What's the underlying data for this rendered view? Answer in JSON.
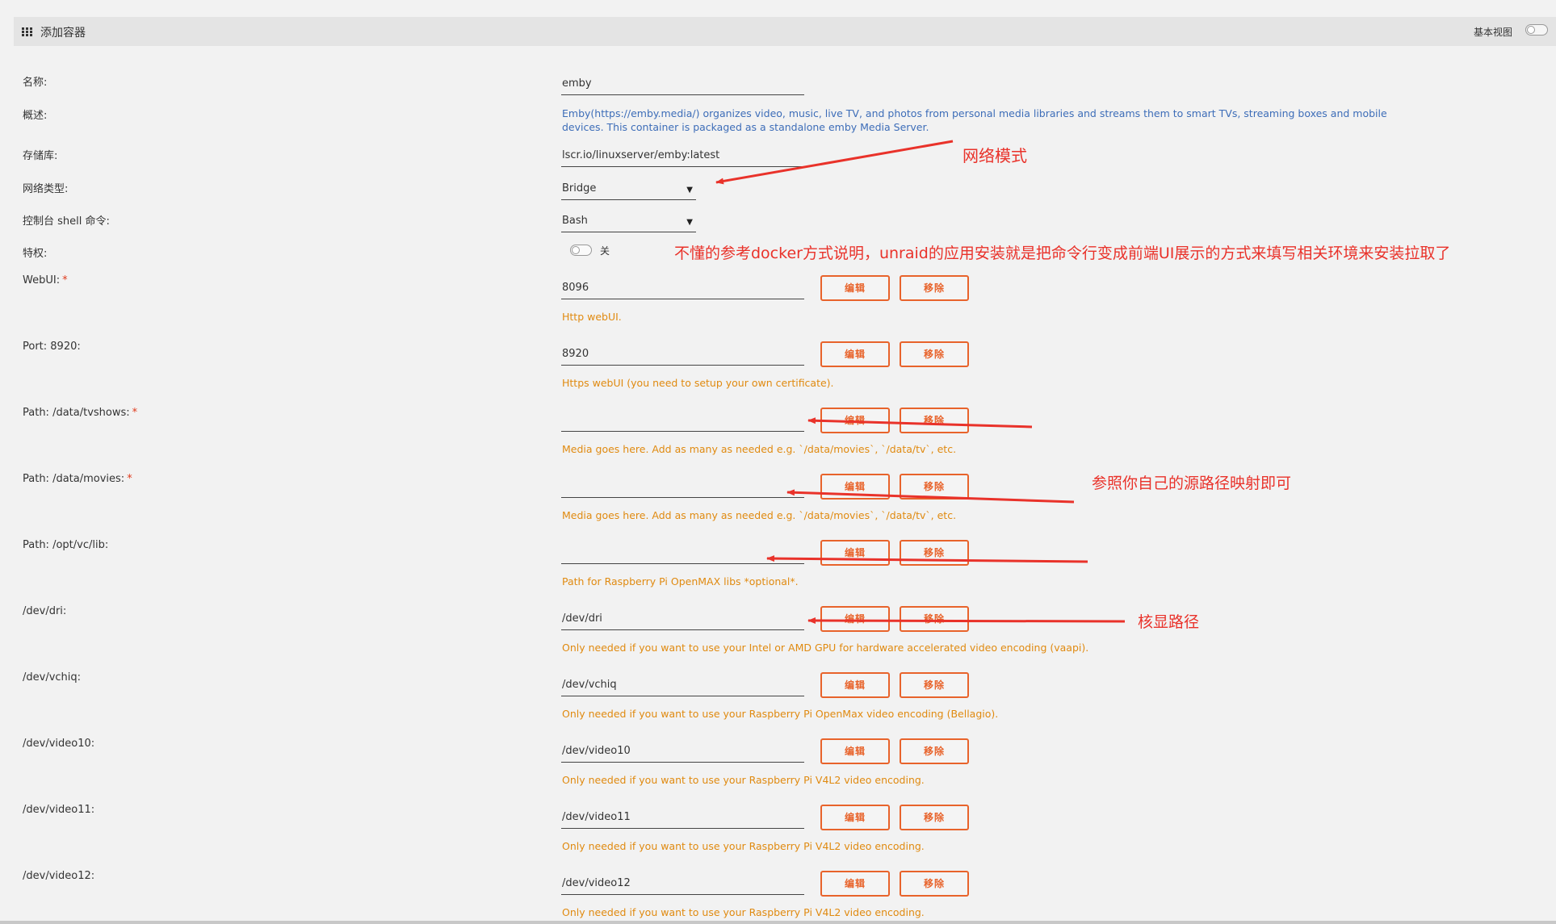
{
  "header": {
    "title": "添加容器",
    "basic_view_label": "基本视图"
  },
  "form": {
    "name": {
      "label": "名称:",
      "value": "emby"
    },
    "overview": {
      "label": "概述:",
      "text": "Emby(https://emby.media/) organizes video, music, live TV, and photos from personal media libraries and streams them to smart TVs, streaming boxes and mobile devices. This container is packaged as a standalone emby Media Server."
    },
    "repository": {
      "label": "存储库:",
      "value": "lscr.io/linuxserver/emby:latest"
    },
    "network": {
      "label": "网络类型:",
      "value": "Bridge"
    },
    "console": {
      "label": "控制台 shell 命令:",
      "value": "Bash"
    },
    "privileged": {
      "label": "特权:",
      "state": "关"
    }
  },
  "entries": [
    {
      "label": "WebUI:",
      "required": true,
      "value": "8096",
      "desc": "Http webUI."
    },
    {
      "label": "Port: 8920:",
      "required": false,
      "value": "8920",
      "desc": "Https webUI (you need to setup your own certificate)."
    },
    {
      "label": "Path: /data/tvshows:",
      "required": true,
      "value": "",
      "desc": "Media goes here. Add as many as needed e.g. `/data/movies`, `/data/tv`, etc."
    },
    {
      "label": "Path: /data/movies:",
      "required": true,
      "value": "",
      "desc": "Media goes here. Add as many as needed e.g. `/data/movies`, `/data/tv`, etc."
    },
    {
      "label": "Path: /opt/vc/lib:",
      "required": false,
      "value": "",
      "desc": "Path for Raspberry Pi OpenMAX libs *optional*."
    },
    {
      "label": "/dev/dri:",
      "required": false,
      "value": "/dev/dri",
      "desc": "Only needed if you want to use your Intel or AMD GPU for hardware accelerated video encoding (vaapi)."
    },
    {
      "label": "/dev/vchiq:",
      "required": false,
      "value": "/dev/vchiq",
      "desc": "Only needed if you want to use your Raspberry Pi OpenMax video encoding (Bellagio)."
    },
    {
      "label": "/dev/video10:",
      "required": false,
      "value": "/dev/video10",
      "desc": "Only needed if you want to use your Raspberry Pi V4L2 video encoding."
    },
    {
      "label": "/dev/video11:",
      "required": false,
      "value": "/dev/video11",
      "desc": "Only needed if you want to use your Raspberry Pi V4L2 video encoding."
    },
    {
      "label": "/dev/video12:",
      "required": false,
      "value": "/dev/video12",
      "desc": "Only needed if you want to use your Raspberry Pi V4L2 video encoding."
    }
  ],
  "buttons": {
    "edit": "编辑",
    "remove": "移除",
    "required_mark": "*"
  },
  "annotations": {
    "network_mode": "网络模式",
    "explanation": "不懂的参考docker方式说明，unraid的应用安装就是把命令行变成前端UI展示的方式来填写相关环境来安装拉取了",
    "path_mapping": "参照你自己的源路径映射即可",
    "igpu_path": "核显路径"
  },
  "colors": {
    "accent": "#e8632b",
    "desc_orange": "#e08a10",
    "desc_blue": "#3d6db8",
    "annotation_red": "#e9322a"
  }
}
